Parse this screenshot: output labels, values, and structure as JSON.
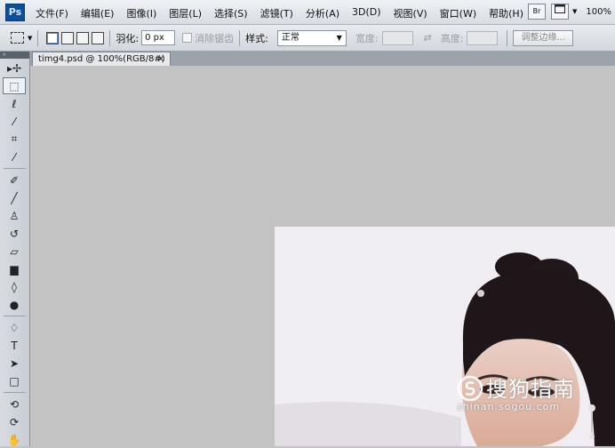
{
  "app": {
    "logo": "Ps"
  },
  "menubar": {
    "items": [
      "文件(F)",
      "编辑(E)",
      "图像(I)",
      "图层(L)",
      "选择(S)",
      "滤镜(T)",
      "分析(A)",
      "3D(D)",
      "视图(V)",
      "窗口(W)",
      "帮助(H)"
    ],
    "bridge_label": "Br",
    "zoom": "100%"
  },
  "options": {
    "feather_label": "羽化:",
    "feather_value": "0 px",
    "antialias_label": "消除锯齿",
    "style_label": "样式:",
    "style_value": "正常",
    "width_label": "宽度:",
    "height_label": "高度:",
    "refine_edge_label": "调整边缘..."
  },
  "document": {
    "tab_title": "timg4.psd @ 100%(RGB/8#)",
    "close_glyph": "×"
  },
  "toolbox": {
    "collapse_glyph": "»",
    "tools": [
      {
        "name": "move-tool",
        "glyph": "▸✢"
      },
      {
        "name": "rect-marquee-tool",
        "glyph": "⬚",
        "active": true
      },
      {
        "name": "lasso-tool",
        "glyph": "ℓ"
      },
      {
        "name": "quick-select-tool",
        "glyph": "⁄"
      },
      {
        "name": "crop-tool",
        "glyph": "⌗"
      },
      {
        "name": "eyedropper-tool",
        "glyph": "⁄"
      },
      {
        "sep": true
      },
      {
        "name": "healing-brush-tool",
        "glyph": "✐"
      },
      {
        "name": "brush-tool",
        "glyph": "╱"
      },
      {
        "name": "clone-stamp-tool",
        "glyph": "♙"
      },
      {
        "name": "history-brush-tool",
        "glyph": "↺"
      },
      {
        "name": "eraser-tool",
        "glyph": "▱"
      },
      {
        "name": "gradient-tool",
        "glyph": "▆"
      },
      {
        "name": "blur-tool",
        "glyph": "◊"
      },
      {
        "name": "dodge-tool",
        "glyph": "●"
      },
      {
        "sep": true
      },
      {
        "name": "pen-tool",
        "glyph": "♢"
      },
      {
        "name": "type-tool",
        "glyph": "T"
      },
      {
        "name": "path-select-tool",
        "glyph": "➤"
      },
      {
        "name": "shape-tool",
        "glyph": "□"
      },
      {
        "sep": true
      },
      {
        "name": "3d-rotate-tool",
        "glyph": "⟲"
      },
      {
        "name": "3d-orbit-tool",
        "glyph": "⟳"
      },
      {
        "name": "hand-tool",
        "glyph": "✋"
      }
    ]
  },
  "watermark": {
    "text": "搜狗指南",
    "url": "zhinan.sogou.com"
  },
  "colors": {
    "canvas": "#c3c3c3",
    "hair": "#1d1518",
    "skin": "#e7c1b4",
    "watermark": "#ffffff"
  }
}
